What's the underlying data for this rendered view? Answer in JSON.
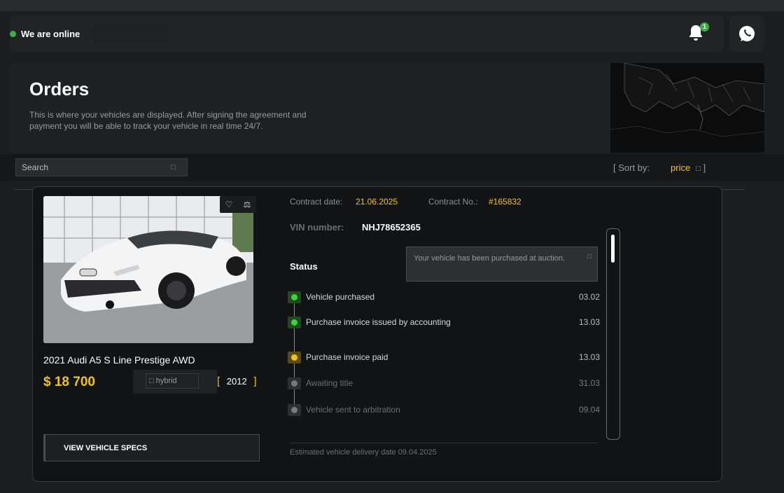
{
  "header": {
    "online_text": "We are online",
    "notification_count": "1"
  },
  "hero": {
    "title": "Orders",
    "description": "This is where your vehicles are displayed. After signing the agreement and payment you will be able to track your vehicle in real time 24/7."
  },
  "toolbar": {
    "search_placeholder": "Search",
    "sort_label": "[ Sort by:",
    "sort_value": "price",
    "sort_close": "]"
  },
  "order": {
    "car_name": "2021 Audi A5 S Line Prestige AWD",
    "price": "$ 18 700",
    "fuel": "hybrid",
    "year": "2012",
    "year_open": "[",
    "year_close": "]",
    "specs_button": "VIEW VEHICLE SPECS",
    "contract_date_label": "Contract date:",
    "contract_date": "21.06.2025",
    "contract_no_label": "Contract No.:",
    "contract_no": "#165832",
    "vin_label": "VIN number:",
    "vin": "NHJ78652365",
    "status_title": "Status",
    "tooltip": "Your vehicle has been purchased at auction.",
    "steps": [
      {
        "name": "Vehicle purchased",
        "date": "03.02",
        "state": "done"
      },
      {
        "name": "Purchase invoice issued by accounting",
        "date": "13.03",
        "state": "done"
      },
      {
        "name": "Purchase invoice paid",
        "date": "13.03",
        "state": "current"
      },
      {
        "name": "Awaiting title",
        "date": "31.03",
        "state": "pending"
      },
      {
        "name": "Vehicle sent to arbitration",
        "date": "09.04",
        "state": "pending"
      }
    ],
    "eta": "Estimated vehicle delivery date 09.04.2025"
  },
  "colors": {
    "accent": "#f0c419",
    "online": "#3fae4a",
    "done": "#2f9e2f",
    "current": "#f0c419",
    "pending": "#7a7a7a"
  }
}
